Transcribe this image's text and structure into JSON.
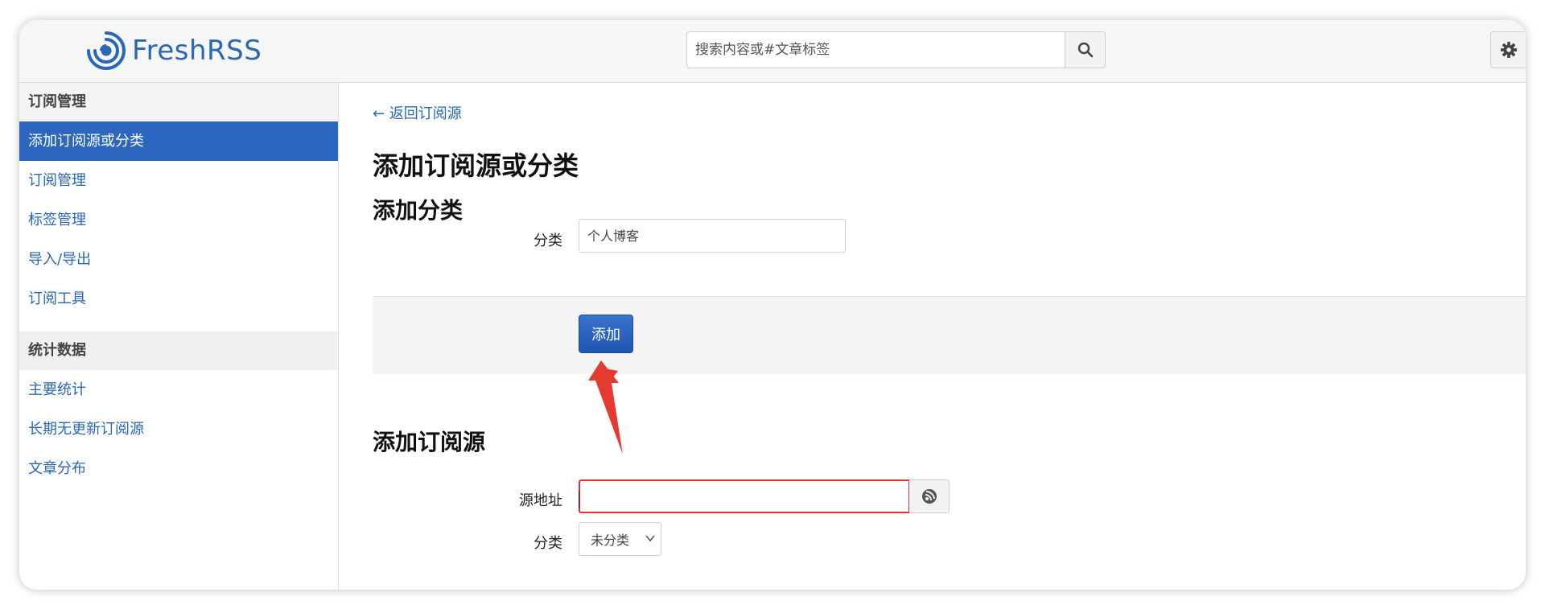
{
  "app": {
    "name": "FreshRSS"
  },
  "header": {
    "search_placeholder": "搜索内容或#文章标签",
    "search_icon": "search-icon",
    "settings_icon": "gear-icon"
  },
  "sidebar": {
    "sections": [
      {
        "title": "订阅管理",
        "items": [
          {
            "label": "添加订阅源或分类",
            "active": true
          },
          {
            "label": "订阅管理"
          },
          {
            "label": "标签管理"
          },
          {
            "label": "导入/导出"
          },
          {
            "label": "订阅工具"
          }
        ]
      },
      {
        "title": "统计数据",
        "items": [
          {
            "label": "主要统计"
          },
          {
            "label": "长期无更新订阅源"
          },
          {
            "label": "文章分布"
          }
        ]
      }
    ]
  },
  "main": {
    "back_link": "← 返回订阅源",
    "title": "添加订阅源或分类",
    "add_category": {
      "heading": "添加分类",
      "field_label": "分类",
      "field_value": "个人博客",
      "button_label": "添加"
    },
    "add_feed": {
      "heading": "添加订阅源",
      "url_label": "源地址",
      "url_value": "",
      "url_button_icon": "feed-icon",
      "category_label": "分类",
      "category_selected": "未分类"
    }
  },
  "colors": {
    "brand": "#2a67b5",
    "active_sidebar": "#2b66c0",
    "primary_button": "#2b63c4",
    "error_border": "#e0342b",
    "annotation_arrow": "#e53a2f"
  }
}
